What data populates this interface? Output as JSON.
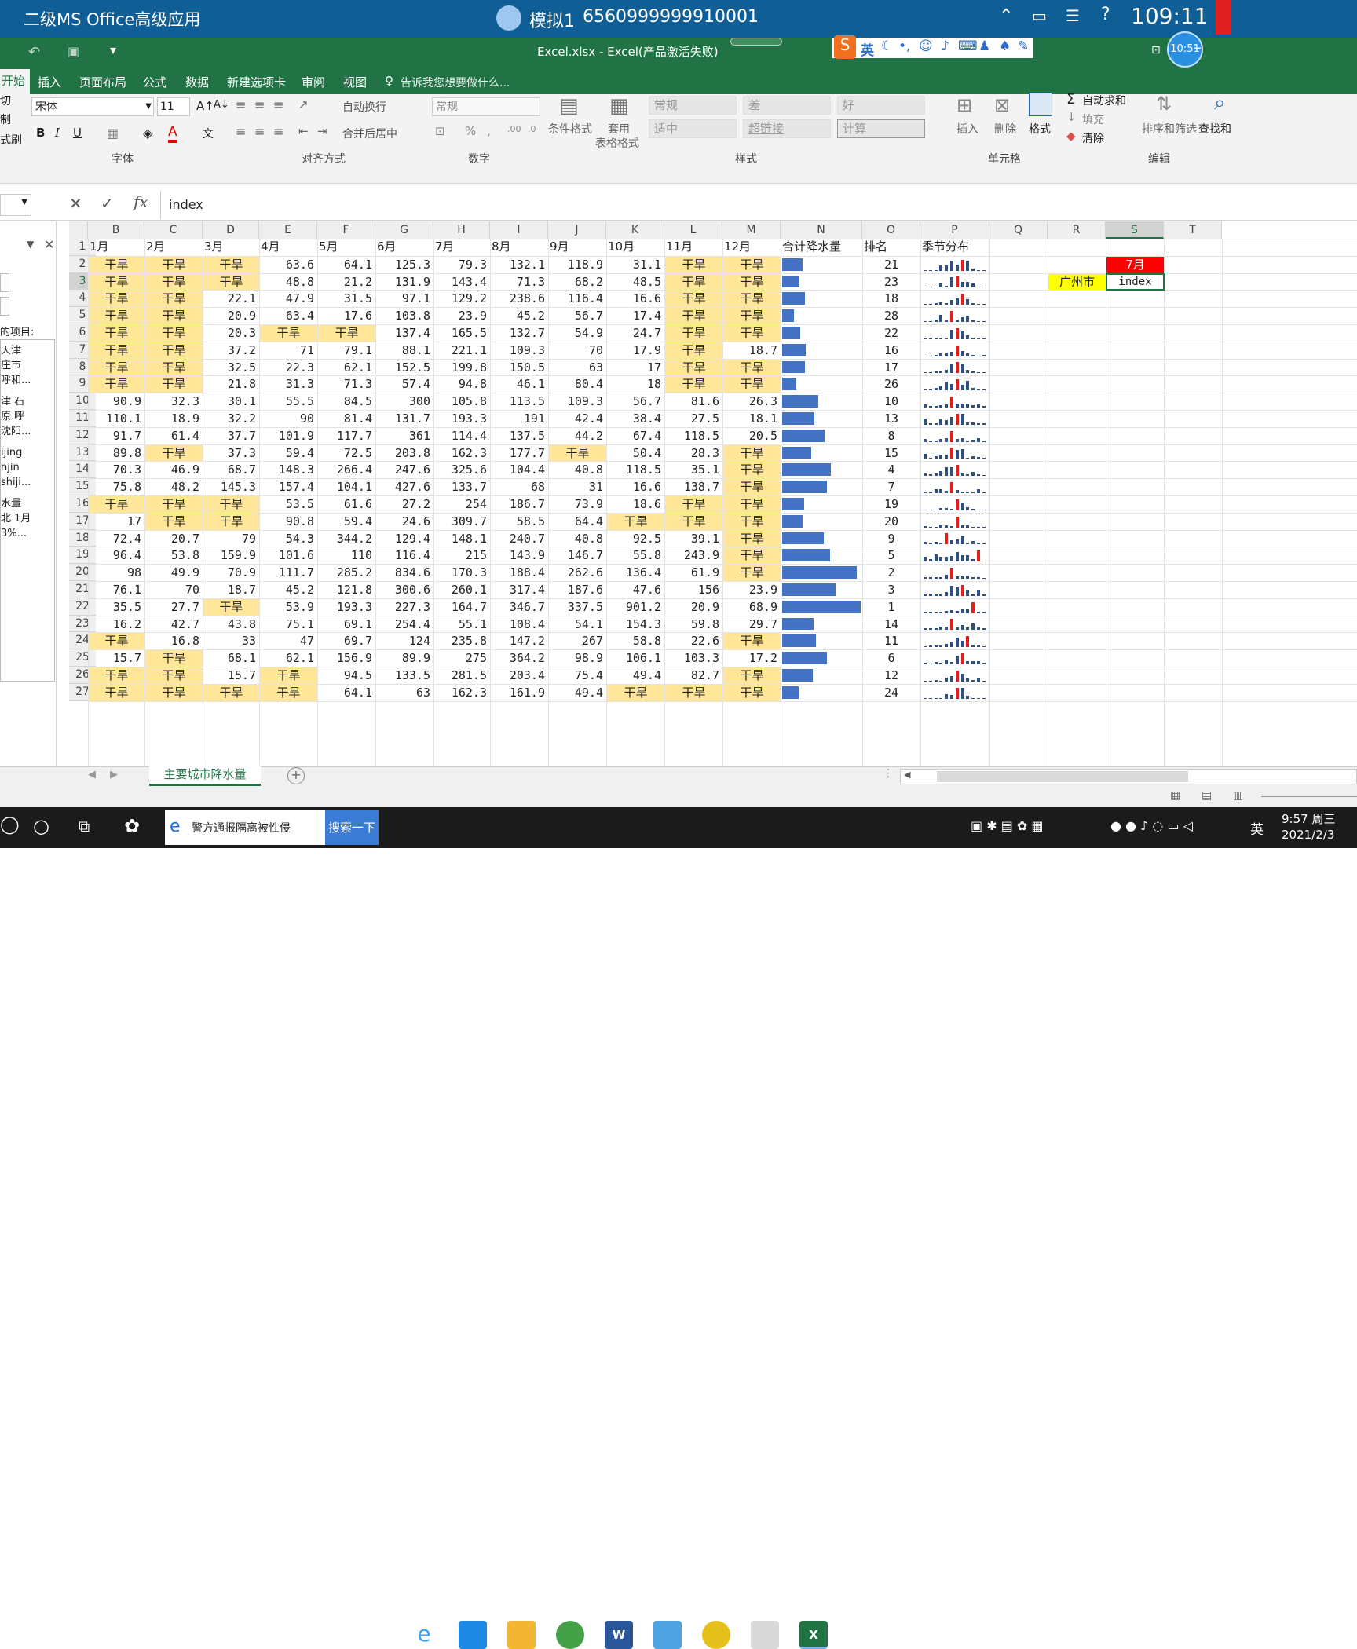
{
  "topbar": {
    "app_title": "二级MS Office高级应用",
    "exam_label": "模拟1",
    "exam_id": "6560999999910001",
    "timer": "109:11",
    "clock_badge": "10:51"
  },
  "window": {
    "title": "Excel.xlsx - Excel(产品激活失败)"
  },
  "ime": {
    "lang": "英"
  },
  "tabs": [
    "开始",
    "插入",
    "页面布局",
    "公式",
    "数据",
    "新建选项卡",
    "审阅",
    "视图"
  ],
  "tell_me": "告诉我您想要做什么...",
  "ribbon": {
    "clipboard": [
      "切",
      "制",
      "式刷"
    ],
    "font_name": "宋体",
    "font_size": "11",
    "font_group": "字体",
    "align_group": "对齐方式",
    "number_group": "数字",
    "styles_group": "样式",
    "cells_group": "单元格",
    "edit_group": "编辑",
    "wrap_text": "自动换行",
    "merge_center": "合并后居中",
    "number_format": "常规",
    "cond_format": "条件格式",
    "table_format_1": "套用",
    "table_format_2": "表格格式",
    "styles": [
      "常规",
      "差",
      "好",
      "适中",
      "超链接",
      "计算"
    ],
    "insert": "插入",
    "delete": "删除",
    "format": "格式",
    "autosum": "自动求和",
    "fill": "填充",
    "clear": "清除",
    "sort_filter": "排序和筛选",
    "find_select": "查找和"
  },
  "formula_bar": {
    "content": "index"
  },
  "side_pane": {
    "title": "的项目:",
    "items": [
      "天津",
      "庄市",
      "呼和...",
      "津 石",
      "原 呼",
      "沈阳...",
      "ijing",
      "njin",
      "shiji...",
      "水量",
      "北 1月",
      "3%..."
    ]
  },
  "columns": [
    "B",
    "C",
    "D",
    "E",
    "F",
    "G",
    "H",
    "I",
    "J",
    "K",
    "L",
    "M",
    "N",
    "O",
    "P",
    "Q",
    "R",
    "S",
    "T"
  ],
  "header_row": [
    "1月",
    "2月",
    "3月",
    "4月",
    "5月",
    "6月",
    "7月",
    "8月",
    "9月",
    "10月",
    "11月",
    "12月",
    "合计降水量",
    "排名",
    "季节分布"
  ],
  "rows": [
    {
      "n": "2",
      "v": [
        "干旱",
        "干旱",
        "干旱",
        "63.6",
        "64.1",
        "125.3",
        "79.3",
        "132.1",
        "118.9",
        "31.1",
        "干旱",
        "干旱"
      ],
      "rank": "21"
    },
    {
      "n": "3",
      "v": [
        "干旱",
        "干旱",
        "干旱",
        "48.8",
        "21.2",
        "131.9",
        "143.4",
        "71.3",
        "68.2",
        "48.5",
        "干旱",
        "干旱"
      ],
      "rank": "23"
    },
    {
      "n": "4",
      "v": [
        "干旱",
        "干旱",
        "22.1",
        "47.9",
        "31.5",
        "97.1",
        "129.2",
        "238.6",
        "116.4",
        "16.6",
        "干旱",
        "干旱"
      ],
      "rank": "18"
    },
    {
      "n": "5",
      "v": [
        "干旱",
        "干旱",
        "20.9",
        "63.4",
        "17.6",
        "103.8",
        "23.9",
        "45.2",
        "56.7",
        "17.4",
        "干旱",
        "干旱"
      ],
      "rank": "28"
    },
    {
      "n": "6",
      "v": [
        "干旱",
        "干旱",
        "20.3",
        "干旱",
        "干旱",
        "137.4",
        "165.5",
        "132.7",
        "54.9",
        "24.7",
        "干旱",
        "干旱"
      ],
      "rank": "22"
    },
    {
      "n": "7",
      "v": [
        "干旱",
        "干旱",
        "37.2",
        "71",
        "79.1",
        "88.1",
        "221.1",
        "109.3",
        "70",
        "17.9",
        "干旱",
        "18.7"
      ],
      "rank": "16"
    },
    {
      "n": "8",
      "v": [
        "干旱",
        "干旱",
        "32.5",
        "22.3",
        "62.1",
        "152.5",
        "199.8",
        "150.5",
        "63",
        "17",
        "干旱",
        "干旱"
      ],
      "rank": "17"
    },
    {
      "n": "9",
      "v": [
        "干旱",
        "干旱",
        "21.8",
        "31.3",
        "71.3",
        "57.4",
        "94.8",
        "46.1",
        "80.4",
        "18",
        "干旱",
        "干旱"
      ],
      "rank": "26"
    },
    {
      "n": "10",
      "v": [
        "90.9",
        "32.3",
        "30.1",
        "55.5",
        "84.5",
        "300",
        "105.8",
        "113.5",
        "109.3",
        "56.7",
        "81.6",
        "26.3"
      ],
      "rank": "10"
    },
    {
      "n": "11",
      "v": [
        "110.1",
        "18.9",
        "32.2",
        "90",
        "81.4",
        "131.7",
        "193.3",
        "191",
        "42.4",
        "38.4",
        "27.5",
        "18.1"
      ],
      "rank": "13"
    },
    {
      "n": "12",
      "v": [
        "91.7",
        "61.4",
        "37.7",
        "101.9",
        "117.7",
        "361",
        "114.4",
        "137.5",
        "44.2",
        "67.4",
        "118.5",
        "20.5"
      ],
      "rank": "8"
    },
    {
      "n": "13",
      "v": [
        "89.8",
        "干旱",
        "37.3",
        "59.4",
        "72.5",
        "203.8",
        "162.3",
        "177.7",
        "干旱",
        "50.4",
        "28.3",
        "干旱"
      ],
      "rank": "15"
    },
    {
      "n": "14",
      "v": [
        "70.3",
        "46.9",
        "68.7",
        "148.3",
        "266.4",
        "247.6",
        "325.6",
        "104.4",
        "40.8",
        "118.5",
        "35.1",
        "干旱"
      ],
      "rank": "4"
    },
    {
      "n": "15",
      "v": [
        "75.8",
        "48.2",
        "145.3",
        "157.4",
        "104.1",
        "427.6",
        "133.7",
        "68",
        "31",
        "16.6",
        "138.7",
        "干旱"
      ],
      "rank": "7"
    },
    {
      "n": "16",
      "v": [
        "干旱",
        "干旱",
        "干旱",
        "53.5",
        "61.6",
        "27.2",
        "254",
        "186.7",
        "73.9",
        "18.6",
        "干旱",
        "干旱"
      ],
      "rank": "19"
    },
    {
      "n": "17",
      "v": [
        "17",
        "干旱",
        "干旱",
        "90.8",
        "59.4",
        "24.6",
        "309.7",
        "58.5",
        "64.4",
        "干旱",
        "干旱",
        "干旱"
      ],
      "rank": "20"
    },
    {
      "n": "18",
      "v": [
        "72.4",
        "20.7",
        "79",
        "54.3",
        "344.2",
        "129.4",
        "148.1",
        "240.7",
        "40.8",
        "92.5",
        "39.1",
        "干旱"
      ],
      "rank": "9"
    },
    {
      "n": "19",
      "v": [
        "96.4",
        "53.8",
        "159.9",
        "101.6",
        "110",
        "116.4",
        "215",
        "143.9",
        "146.7",
        "55.8",
        "243.9",
        "干旱"
      ],
      "rank": "5"
    },
    {
      "n": "20",
      "v": [
        "98",
        "49.9",
        "70.9",
        "111.7",
        "285.2",
        "834.6",
        "170.3",
        "188.4",
        "262.6",
        "136.4",
        "61.9",
        "干旱"
      ],
      "rank": "2"
    },
    {
      "n": "21",
      "v": [
        "76.1",
        "70",
        "18.7",
        "45.2",
        "121.8",
        "300.6",
        "260.1",
        "317.4",
        "187.6",
        "47.6",
        "156",
        "23.9"
      ],
      "rank": "3"
    },
    {
      "n": "22",
      "v": [
        "35.5",
        "27.7",
        "干旱",
        "53.9",
        "193.3",
        "227.3",
        "164.7",
        "346.7",
        "337.5",
        "901.2",
        "20.9",
        "68.9"
      ],
      "rank": "1"
    },
    {
      "n": "23",
      "v": [
        "16.2",
        "42.7",
        "43.8",
        "75.1",
        "69.1",
        "254.4",
        "55.1",
        "108.4",
        "54.1",
        "154.3",
        "59.8",
        "29.7"
      ],
      "rank": "14"
    },
    {
      "n": "24",
      "v": [
        "干旱",
        "16.8",
        "33",
        "47",
        "69.7",
        "124",
        "235.8",
        "147.2",
        "267",
        "58.8",
        "22.6",
        "干旱"
      ],
      "rank": "11"
    },
    {
      "n": "25",
      "v": [
        "15.7",
        "干旱",
        "68.1",
        "62.1",
        "156.9",
        "89.9",
        "275",
        "364.2",
        "98.9",
        "106.1",
        "103.3",
        "17.2"
      ],
      "rank": "6"
    },
    {
      "n": "26",
      "v": [
        "干旱",
        "干旱",
        "15.7",
        "干旱",
        "94.5",
        "133.5",
        "281.5",
        "203.4",
        "75.4",
        "49.4",
        "82.7",
        "干旱"
      ],
      "rank": "12"
    },
    {
      "n": "27",
      "v": [
        "干旱",
        "干旱",
        "干旱",
        "干旱",
        "64.1",
        "63",
        "162.3",
        "161.9",
        "49.4",
        "干旱",
        "干旱",
        "干旱"
      ],
      "rank": "24"
    }
  ],
  "lookup": {
    "month_header": "7月",
    "city_label": "广州市",
    "active_cell": "index"
  },
  "sheet_tab": "主要城市降水量",
  "taskbar": {
    "search_text": "警方通报隔离被性侵",
    "search_button": "搜索一下",
    "time": "9:57 周三",
    "date": "2021/2/3",
    "ime": "英"
  },
  "colors": {
    "dry": "#ffe699",
    "bar": "#4472c4",
    "spark_peak": "#e02020",
    "excel_green": "#217346",
    "header_red": "#ff0000",
    "label_yellow": "#ffff00"
  }
}
